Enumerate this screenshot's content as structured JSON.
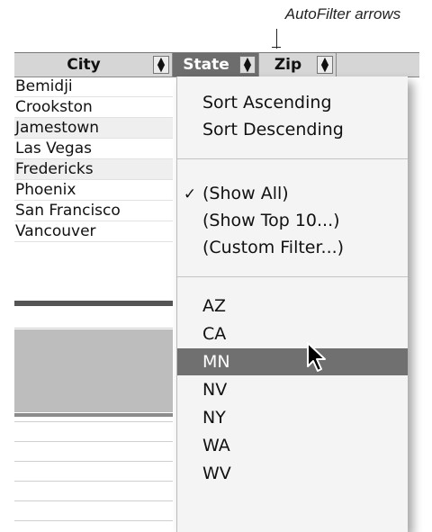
{
  "callout": "AutoFilter arrows",
  "header": {
    "city": "City",
    "state": "State",
    "zip": "Zip",
    "arrow": "⬍"
  },
  "cities": [
    "Bemidji",
    "Crookston",
    "Jamestown",
    "Las Vegas",
    "Fredericks",
    "Phoenix",
    "San Francisco",
    "Vancouver"
  ],
  "menu": {
    "sort_asc": "Sort Ascending",
    "sort_desc": "Sort Descending",
    "checkmark": "✓",
    "show_all": "(Show All)",
    "show_top10": "(Show Top 10...)",
    "custom_filter": "(Custom Filter...)",
    "values": [
      "AZ",
      "CA",
      "MN",
      "NV",
      "NY",
      "WA",
      "WV"
    ],
    "highlighted": "MN"
  },
  "colors": {
    "header_bg": "#d6d6d6",
    "state_header_bg": "#6d6d6d",
    "highlight": "#707070",
    "menu_bg": "#f4f4f4"
  }
}
